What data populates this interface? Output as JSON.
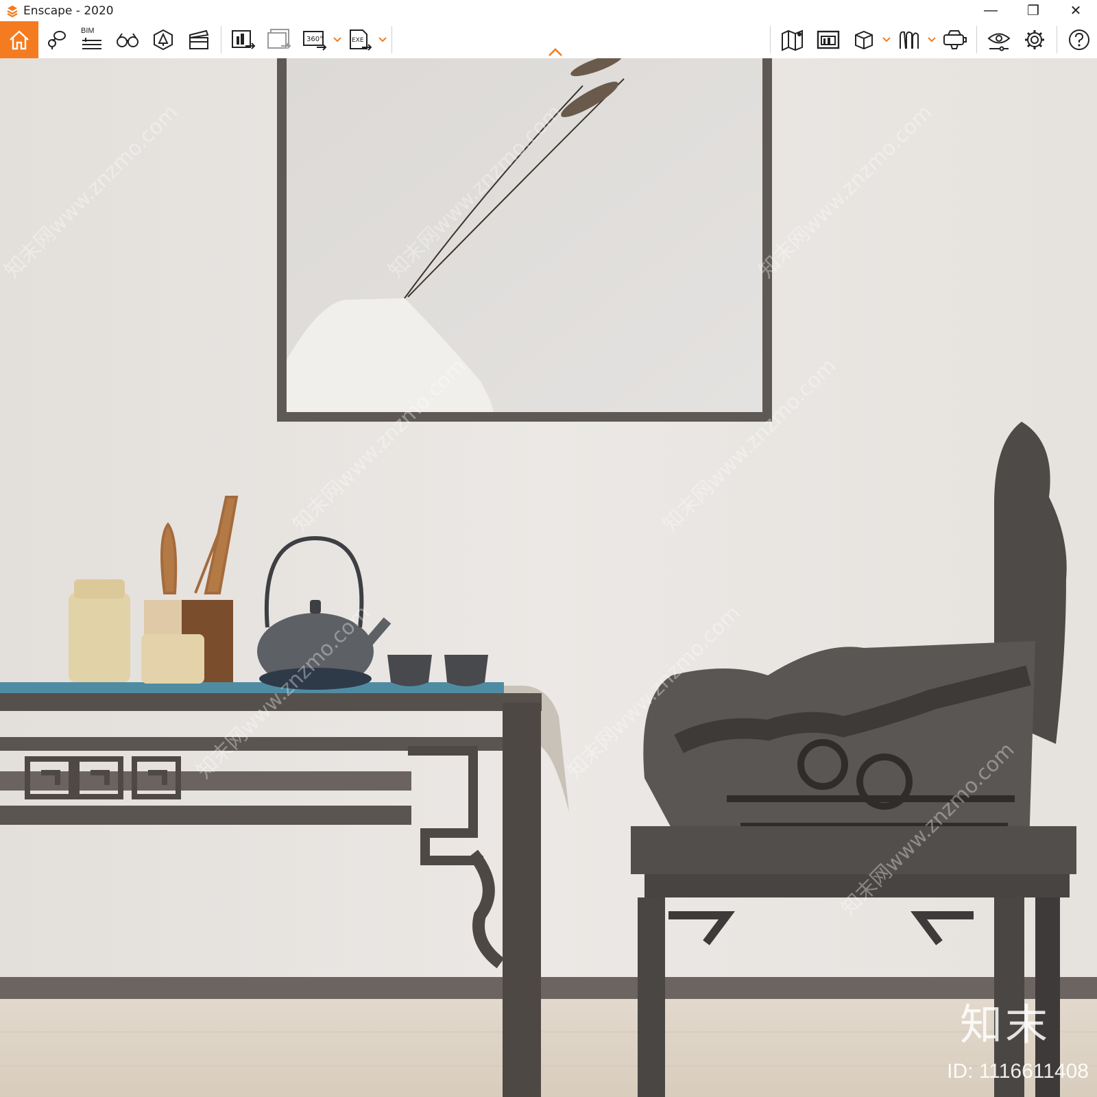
{
  "window": {
    "title": "Enscape - 2020",
    "minimize_glyph": "—",
    "restore_glyph": "❐",
    "close_glyph": "✕"
  },
  "toolbar": {
    "bim_label": "BIM",
    "pano_label": "360°",
    "exe_label": "EXE",
    "accent_color": "#f47b20"
  },
  "watermark": {
    "brand": "知末",
    "id": "ID: 1116611408",
    "site": "知末网www.znzmo.com"
  }
}
